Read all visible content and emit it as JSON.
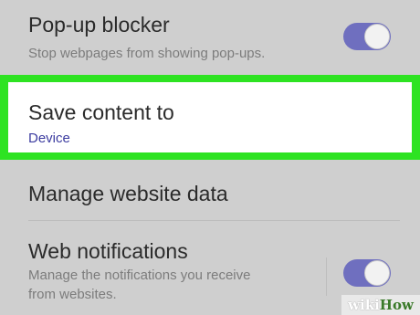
{
  "settings": {
    "popup_blocker": {
      "title": "Pop-up blocker",
      "subtitle": "Stop webpages from showing pop-ups.",
      "enabled": true
    },
    "save_content": {
      "title": "Save content to",
      "value": "Device"
    },
    "manage_data": {
      "title": "Manage website data"
    },
    "web_notifications": {
      "title": "Web notifications",
      "subtitle_line1": "Manage the notifications you receive",
      "subtitle_line2": "from websites.",
      "enabled": true
    }
  },
  "colors": {
    "highlight": "#2ee322",
    "toggle_on": "#6f6fbf",
    "value_text": "#3c3ca0"
  },
  "watermark": {
    "part1": "wiki",
    "part2": "How"
  }
}
